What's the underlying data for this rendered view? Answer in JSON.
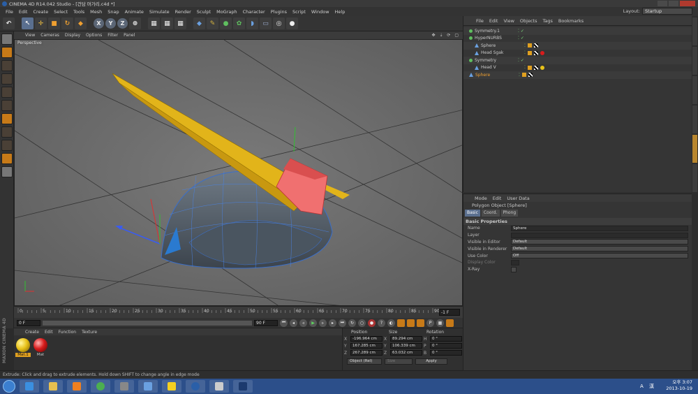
{
  "window": {
    "title": "CINEMA 4D R14.042 Studio - [건담 머가리.c4d *]"
  },
  "menu": [
    "File",
    "Edit",
    "Create",
    "Select",
    "Tools",
    "Mesh",
    "Snap",
    "Animate",
    "Simulate",
    "Render",
    "Sculpt",
    "MoGraph",
    "Character",
    "Plugins",
    "Script",
    "Window",
    "Help"
  ],
  "layout": {
    "label": "Layout:",
    "value": "Startup"
  },
  "toolbar": {
    "axes": [
      "X",
      "Y",
      "Z"
    ]
  },
  "viewport": {
    "menu": [
      "View",
      "Cameras",
      "Display",
      "Options",
      "Filter",
      "Panel"
    ],
    "label": "Perspective"
  },
  "timeline": {
    "ticks": [
      "0",
      "5",
      "10",
      "15",
      "20",
      "25",
      "30",
      "35",
      "40",
      "45",
      "50",
      "55",
      "60",
      "65",
      "70",
      "75",
      "80",
      "85",
      "90"
    ],
    "current": "-1 F",
    "start": "0 F",
    "end": "90 F"
  },
  "materials": {
    "menu": [
      "Create",
      "Edit",
      "Function",
      "Texture"
    ],
    "items": [
      {
        "name": "Mat.1",
        "color": "#e8c21a",
        "selected": true
      },
      {
        "name": "Mat",
        "color": "#d81c1c",
        "selected": false
      }
    ],
    "brand": "MAXON CINEMA 4D"
  },
  "coordinates": {
    "headers": [
      "Position",
      "Size",
      "Rotation"
    ],
    "rows": [
      {
        "axis": "X",
        "pos": "-196.964 cm",
        "saxis": "X",
        "size": "89.294 cm",
        "raxis": "H",
        "rot": "0 °"
      },
      {
        "axis": "Y",
        "pos": "167.285 cm",
        "saxis": "Y",
        "size": "106.339 cm",
        "raxis": "P",
        "rot": "0 °"
      },
      {
        "axis": "Z",
        "pos": "267.289 cm",
        "saxis": "Z",
        "size": "63.032 cm",
        "raxis": "B",
        "rot": "0 °"
      }
    ],
    "mode": "Object (Rel)",
    "size_mode": "Size",
    "apply": "Apply"
  },
  "objects": {
    "menu": [
      "File",
      "Edit",
      "View",
      "Objects",
      "Tags",
      "Bookmarks"
    ],
    "items": [
      {
        "name": "Symmetry.1",
        "icon": "dot",
        "highlight": false
      },
      {
        "name": "HyperNURBS",
        "icon": "dot",
        "highlight": false
      },
      {
        "name": "Sphere",
        "icon": "tri",
        "highlight": false
      },
      {
        "name": "Head Sgak",
        "icon": "tri",
        "highlight": false
      },
      {
        "name": "Symmetry",
        "icon": "dot",
        "highlight": false
      },
      {
        "name": "Head V",
        "icon": "tri",
        "highlight": false
      },
      {
        "name": "Sphere",
        "icon": "tri",
        "highlight": true
      }
    ]
  },
  "attributes": {
    "menu": [
      "Mode",
      "Edit",
      "User Data"
    ],
    "object_title": "Polygon Object [Sphere]",
    "tabs": [
      "Basic",
      "Coord.",
      "Phong"
    ],
    "section": "Basic Properties",
    "rows": [
      {
        "label": "Name",
        "value": "Sphere"
      },
      {
        "label": "Layer",
        "value": ""
      },
      {
        "label": "Visible in Editor",
        "value": "Default"
      },
      {
        "label": "Visible in Renderer",
        "value": "Default"
      },
      {
        "label": "Use Color",
        "value": "Off"
      },
      {
        "label": "Display Color",
        "value": ""
      },
      {
        "label": "X-Ray",
        "value": ""
      }
    ]
  },
  "status": "Extrude: Click and drag to extrude elements. Hold down SHIFT to change angle in edge mode",
  "taskbar": {
    "time": "오후 3:07",
    "date": "2013-10-19",
    "tray": "A 漢"
  }
}
